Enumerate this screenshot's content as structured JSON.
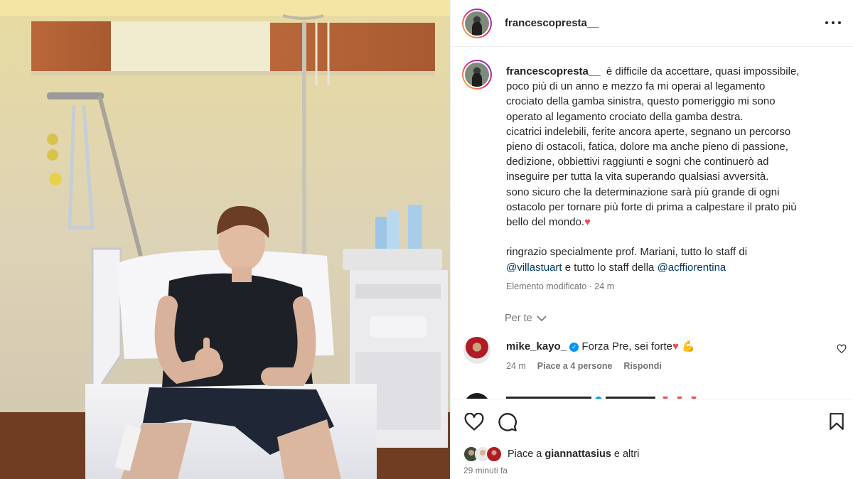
{
  "post": {
    "username": "francescopresta__",
    "caption_lines": [
      "è difficile da accettare, quasi impossibile,",
      "poco più di un anno e mezzo fa mi operai al legamento",
      "crociato della gamba sinistra, questo pomeriggio mi sono",
      "operato al legamento crociato della gamba destra.",
      "cicatrici indelebili, ferite ancora aperte, segnano un percorso",
      "pieno di ostacoli, fatica, dolore ma anche pieno di passione,",
      "dedizione, obbiettivi raggiunti e sogni che continuerò ad",
      "inseguire per tutta la vita superando qualsiasi avversità.",
      "sono sicuro che la determinazione sarà più grande di ogni",
      "ostacolo per tornare più forte di prima a calpestare il prato più",
      "bello del mondo."
    ],
    "thanks_line1": "ringrazio specialmente prof. Mariani, tutto lo staff di",
    "mention1": "@villastuart",
    "thanks_mid": " e tutto lo staff della ",
    "mention2": "@acffiorentina",
    "edited": "Elemento modificato · 24 m",
    "see_translation": "Per te"
  },
  "comment": {
    "username": "mike_kayo_",
    "text": "Forza Pre, sei forte",
    "time": "24 m",
    "likes": "Piace a 4 persone",
    "reply": "Rispondi"
  },
  "likes": {
    "prefix": "Piace a ",
    "user": "giannattasius",
    "suffix": " e altri"
  },
  "time_ago": "29 minuti fa",
  "icons": {
    "more": "more-horizontal-icon",
    "like": "heart-outline-icon",
    "comment": "speech-bubble-icon",
    "save": "bookmark-icon",
    "verified": "verified-badge-icon",
    "chevron": "chevron-down-icon"
  },
  "colors": {
    "text": "#262626",
    "muted": "#737373",
    "mention": "#00376b",
    "heart": "#ed4956",
    "verified": "#0095f6"
  }
}
